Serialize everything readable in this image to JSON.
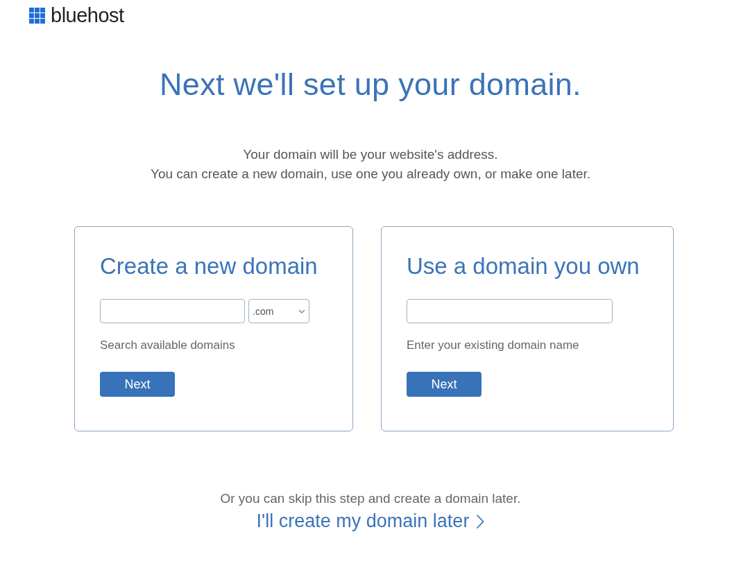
{
  "logo": {
    "text": "bluehost"
  },
  "heading": "Next we'll set up your domain.",
  "intro": [
    "Your domain will be your website's address.",
    "You can create a new domain, use one you already own, or make one later."
  ],
  "cards": [
    {
      "title": "Create a new domain",
      "fields": [
        {
          "kind": "text"
        },
        {
          "kind": "select",
          "value": ".com"
        }
      ],
      "helper": "Search available domains",
      "button": "Next"
    },
    {
      "title": "Use a domain you own",
      "fields": [
        {
          "kind": "text"
        }
      ],
      "helper": "Enter your existing domain name",
      "button": "Next"
    }
  ],
  "skip": {
    "text": "Or you can skip this step and create a domain later.",
    "link": "I'll create my domain later"
  }
}
